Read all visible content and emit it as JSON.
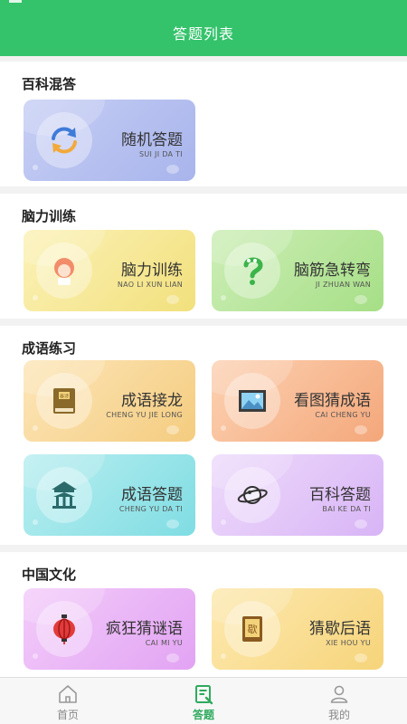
{
  "header": {
    "title": "答题列表"
  },
  "colors": {
    "brand": "#34c36b",
    "tab_active": "#2faa5e"
  },
  "sections": [
    {
      "title": "百科混答",
      "cards": [
        {
          "title": "随机答题",
          "pinyin": "SUI JI DA TI",
          "icon": "refresh-icon"
        }
      ]
    },
    {
      "title": "脑力训练",
      "cards": [
        {
          "title": "脑力训练",
          "pinyin": "NAO LI XUN LIAN",
          "icon": "girl-avatar-icon"
        },
        {
          "title": "脑筋急转弯",
          "pinyin": "JI ZHUAN WAN",
          "icon": "question-snake-icon"
        }
      ]
    },
    {
      "title": "成语练习",
      "cards": [
        {
          "title": "成语接龙",
          "pinyin": "CHENG YU JIE LONG",
          "icon": "book-icon"
        },
        {
          "title": "看图猜成语",
          "pinyin": "CAI CHENG YU",
          "icon": "picture-icon"
        },
        {
          "title": "成语答题",
          "pinyin": "CHENG YU DA TI",
          "icon": "pavilion-icon"
        },
        {
          "title": "百科答题",
          "pinyin": "BAI KE DA TI",
          "icon": "planet-icon"
        }
      ]
    },
    {
      "title": "中国文化",
      "cards": [
        {
          "title": "疯狂猜谜语",
          "pinyin": "CAI MI YU",
          "icon": "lantern-icon"
        },
        {
          "title": "猜歇后语",
          "pinyin": "XIE HOU YU",
          "icon": "xie-book-icon"
        }
      ]
    }
  ],
  "book_glyph": "春诗",
  "xie_glyph": "歇",
  "tabs": [
    {
      "label": "首页",
      "icon": "home-icon",
      "active": false
    },
    {
      "label": "答题",
      "icon": "quiz-icon",
      "active": true
    },
    {
      "label": "我的",
      "icon": "user-icon",
      "active": false
    }
  ]
}
